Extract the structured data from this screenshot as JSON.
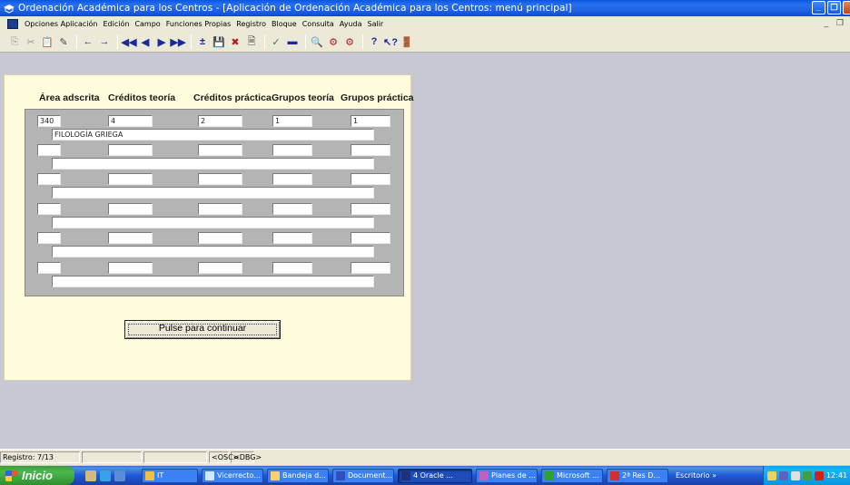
{
  "window": {
    "title": "Ordenación Académica para los Centros - [Aplicación de Ordenación Académica para los Centros: menú principal]",
    "btn_minimize": "_",
    "btn_restore": "❐",
    "btn_close": "x"
  },
  "menu": {
    "items": [
      "Opciones Aplicación",
      "Edición",
      "Campo",
      "Funciones Propias",
      "Registro",
      "Bloque",
      "Consulta",
      "Ayuda",
      "Salir"
    ],
    "mdi_controls": "_ ❐"
  },
  "form": {
    "headers": [
      "Área adscrita",
      "Créditos teoría",
      "Créditos práctica",
      "Grupos teoría",
      "Grupos práctica"
    ],
    "rows": [
      {
        "area": "340",
        "creditos_teoria": "4",
        "creditos_practica": "2",
        "grupos_teoria": "1",
        "grupos_practica": "1",
        "descripcion": "FILOLOGÍA GRIEGA"
      },
      {
        "area": "",
        "creditos_teoria": "",
        "creditos_practica": "",
        "grupos_teoria": "",
        "grupos_practica": "",
        "descripcion": ""
      },
      {
        "area": "",
        "creditos_teoria": "",
        "creditos_practica": "",
        "grupos_teoria": "",
        "grupos_practica": "",
        "descripcion": ""
      },
      {
        "area": "",
        "creditos_teoria": "",
        "creditos_practica": "",
        "grupos_teoria": "",
        "grupos_practica": "",
        "descripcion": ""
      },
      {
        "area": "",
        "creditos_teoria": "",
        "creditos_practica": "",
        "grupos_teoria": "",
        "grupos_practica": "",
        "descripcion": ""
      },
      {
        "area": "",
        "creditos_teoria": "",
        "creditos_practica": "",
        "grupos_teoria": "",
        "grupos_practica": "",
        "descripcion": ""
      }
    ],
    "continue_button": "Pulse para continuar"
  },
  "status": {
    "record": "Registro: 7/13",
    "osc": "<OSC>",
    "dbg": "<DBG>"
  },
  "taskbar": {
    "start_label": "Inicio",
    "tasks": [
      {
        "label": "IT",
        "icon_color": "#f0c040"
      },
      {
        "label": "Vicerrecto...",
        "icon_color": "#d0e8ff"
      },
      {
        "label": "Bandeja d...",
        "icon_color": "#f8d070"
      },
      {
        "label": "Document...",
        "icon_color": "#3050c0"
      },
      {
        "label": "4 Oracle ...",
        "icon_color": "#203080"
      },
      {
        "label": "Planes de ...",
        "icon_color": "#c060c0"
      },
      {
        "label": "Microsoft ...",
        "icon_color": "#30a030"
      },
      {
        "label": "2ª Res D...",
        "icon_color": "#d03030"
      }
    ],
    "desktop_label": "Escritorio",
    "chevron": "»",
    "clock": "12:41"
  },
  "colors": {
    "title_bar": "#1a5fe0",
    "workspace": "#c8c8d4",
    "canvas": "#fffcdc",
    "block": "#b4b4b4"
  }
}
